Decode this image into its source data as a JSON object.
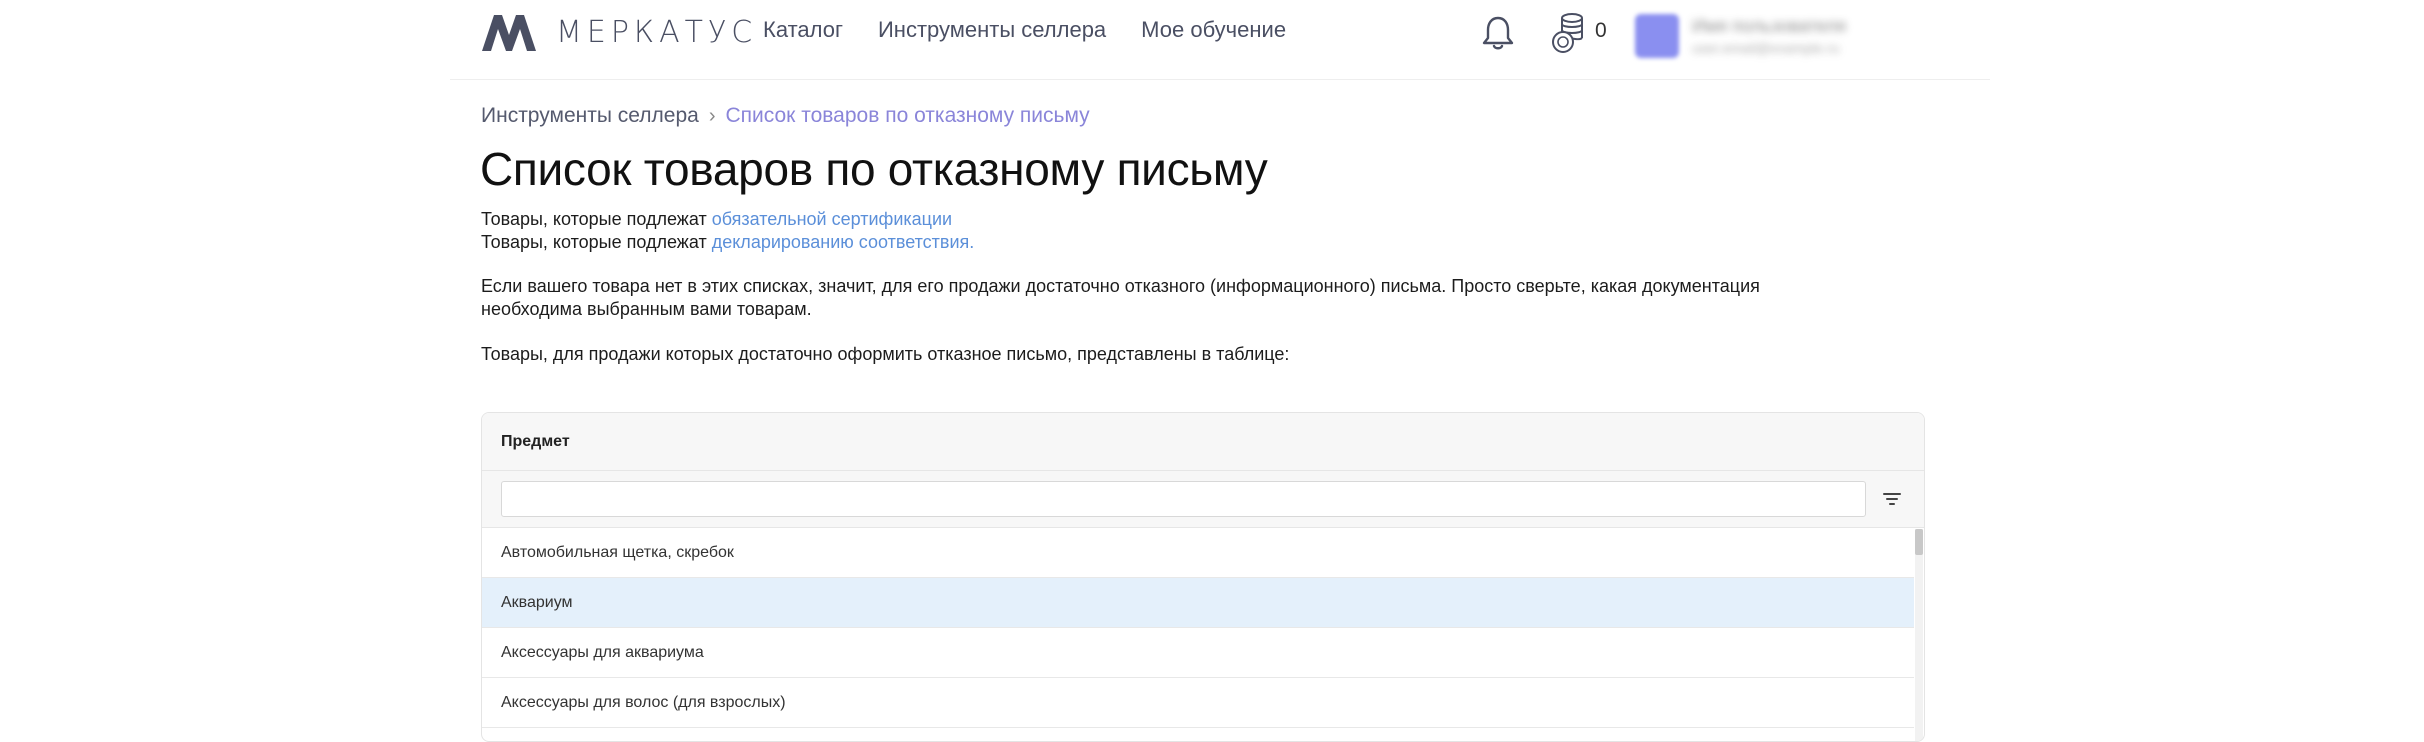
{
  "header": {
    "logo_text": "МЕРКАТУС",
    "nav": [
      {
        "label": "Каталог"
      },
      {
        "label": "Инструменты селлера"
      },
      {
        "label": "Мое обучение"
      }
    ],
    "coins_count": "0",
    "user": {
      "name": "Имя пользователя",
      "email": "user.email@example.ru"
    }
  },
  "breadcrumb": {
    "parent": "Инструменты селлера",
    "separator": "›",
    "current": "Список товаров по отказному письму"
  },
  "page": {
    "title": "Список товаров по отказному письму",
    "line1_prefix": "Товары, которые подлежат ",
    "line1_link": "обязательной сертификации",
    "line2_prefix": "Товары, которые подлежат ",
    "line2_link": "декларированию соответствия.",
    "paragraph2": "Если вашего товара нет в этих списках, значит, для его продажи достаточно отказного (информационного) письма. Просто сверьте, какая документация необходима выбранным вами товарам.",
    "paragraph3": "Товары, для продажи которых достаточно оформить отказное письмо, представлены в таблице:"
  },
  "table": {
    "column_header": "Предмет",
    "filter_value": "",
    "rows": [
      {
        "label": "Автомобильная щетка, скребок"
      },
      {
        "label": "Аквариум"
      },
      {
        "label": "Аксессуары для аквариума"
      },
      {
        "label": "Аксессуары для волос (для взрослых)"
      }
    ],
    "selected_row": "Аквариум"
  },
  "colors": {
    "accent_link": "#5b8fd9",
    "breadcrumb_current": "#8a85d9",
    "selected_row_bg": "#e4f0fb",
    "avatar": "#8a8ff0"
  }
}
